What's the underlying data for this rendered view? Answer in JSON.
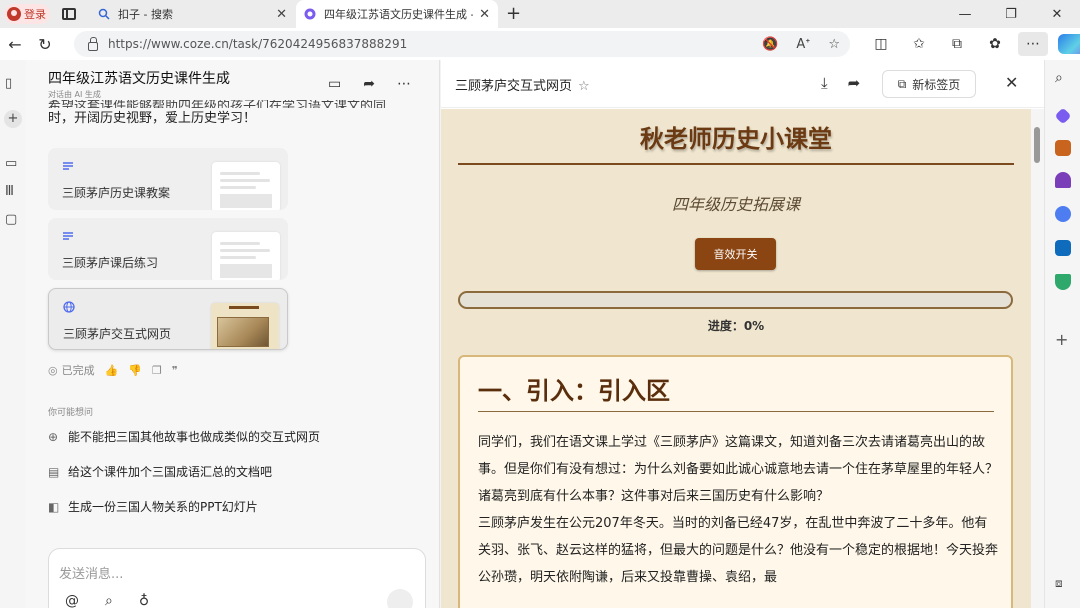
{
  "browser": {
    "login_label": "登录",
    "tabs": [
      {
        "title": "扣子 - 搜索"
      },
      {
        "title": "四年级江苏语文历史课件生成 - 扣"
      }
    ],
    "url": "https://www.coze.cn/task/7620424956837888291"
  },
  "left_panel": {
    "title": "四年级江苏语文历史课件生成",
    "subtitle": "对话由 AI 生成",
    "desc_cut": "希望这套课件能够帮助四年级的孩子们在学习语文课文的同",
    "desc": "时，开阔历史视野，爱上历史学习！",
    "cards": [
      {
        "label": "三顾茅庐历史课教案",
        "icon": "document-icon"
      },
      {
        "label": "三顾茅庐课后练习",
        "icon": "document-icon"
      },
      {
        "label": "三顾茅庐交互式网页",
        "icon": "globe-icon"
      }
    ],
    "done_label": "已完成",
    "maybe_label": "你可能想问",
    "suggestions": [
      {
        "text": "能不能把三国其他故事也做成类似的交互式网页",
        "icon": "globe-icon"
      },
      {
        "text": "给这个课件加个三国成语汇总的文档吧",
        "icon": "document-icon"
      },
      {
        "text": "生成一份三国人物关系的PPT幻灯片",
        "icon": "slides-icon"
      }
    ],
    "input_placeholder": "发送消息..."
  },
  "right_panel": {
    "title": "三顾茅庐交互式网页",
    "new_tab_label": "新标签页"
  },
  "webpage": {
    "title": "秋老师历史小课堂",
    "subtitle": "四年级历史拓展课",
    "sound_button": "音效开关",
    "progress_value": 0,
    "progress_text": "进度：0%",
    "section_heading": "一、引入：引入区",
    "paragraph1": "同学们，我们在语文课上学过《三顾茅庐》这篇课文，知道刘备三次去请诸葛亮出山的故事。但是你们有没有想过：为什么刘备要如此诚心诚意地去请一个住在茅草屋里的年轻人？诸葛亮到底有什么本事？这件事对后来三国历史有什么影响？",
    "paragraph2": "三顾茅庐发生在公元207年冬天。当时的刘备已经47岁，在乱世中奔波了二十多年。他有关羽、张飞、赵云这样的猛将，但最大的问题是什么？他没有一个稳定的根据地！今天投奔公孙瓒，明天依附陶谦，后来又投靠曹操、袁绍，最"
  },
  "colors": {
    "accent": "#8b4513",
    "page_bg": "#f0e6cf",
    "title": "#6b3a12"
  }
}
